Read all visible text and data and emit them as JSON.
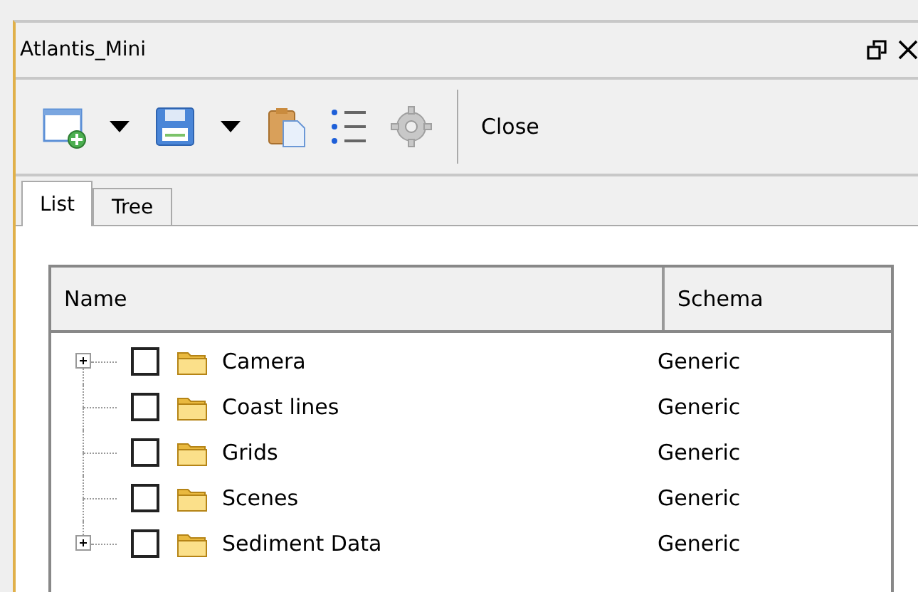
{
  "window": {
    "title": "Atlantis_Mini"
  },
  "toolbar": {
    "close_label": "Close"
  },
  "tabs": [
    {
      "label": "List",
      "selected": true
    },
    {
      "label": "Tree",
      "selected": false
    }
  ],
  "table": {
    "columns": [
      "Name",
      "Schema"
    ],
    "rows": [
      {
        "name": "Camera",
        "schema": "Generic",
        "has_children": true,
        "checked": false
      },
      {
        "name": "Coast lines",
        "schema": "Generic",
        "has_children": false,
        "checked": false
      },
      {
        "name": "Grids",
        "schema": "Generic",
        "has_children": false,
        "checked": false
      },
      {
        "name": "Scenes",
        "schema": "Generic",
        "has_children": false,
        "checked": false
      },
      {
        "name": "Sediment Data",
        "schema": "Generic",
        "has_children": true,
        "checked": false
      }
    ]
  }
}
